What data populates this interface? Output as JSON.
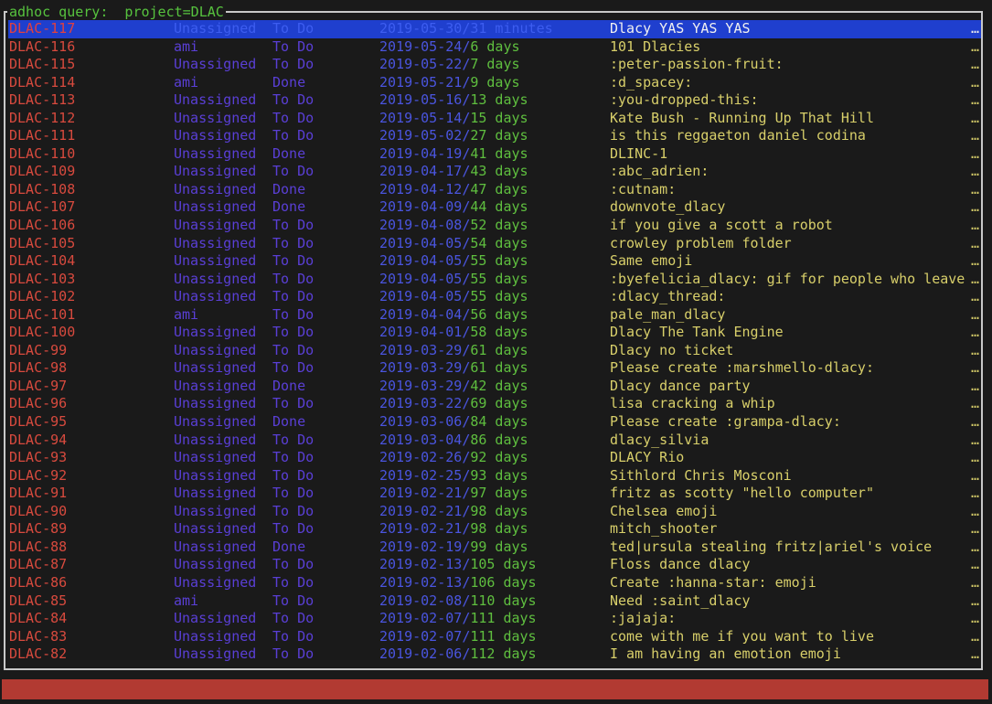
{
  "window": {
    "title": "adhoc query:  project=DLAC"
  },
  "ellipsis": "…",
  "issues": [
    {
      "key": "DLAC-117",
      "assignee": "Unassigned",
      "status": "To Do",
      "date": "2019-05-30",
      "age": "31 minutes",
      "summary": "Dlacy YAS YAS YAS",
      "selected": true
    },
    {
      "key": "DLAC-116",
      "assignee": "ami",
      "status": "To Do",
      "date": "2019-05-24",
      "age": "6 days",
      "summary": "101 Dlacies"
    },
    {
      "key": "DLAC-115",
      "assignee": "Unassigned",
      "status": "To Do",
      "date": "2019-05-22",
      "age": "7 days",
      "summary": ":peter-passion-fruit:"
    },
    {
      "key": "DLAC-114",
      "assignee": "ami",
      "status": "Done",
      "date": "2019-05-21",
      "age": "9 days",
      "summary": ":d_spacey:"
    },
    {
      "key": "DLAC-113",
      "assignee": "Unassigned",
      "status": "To Do",
      "date": "2019-05-16",
      "age": "13 days",
      "summary": ":you-dropped-this:"
    },
    {
      "key": "DLAC-112",
      "assignee": "Unassigned",
      "status": "To Do",
      "date": "2019-05-14",
      "age": "15 days",
      "summary": "Kate Bush - Running Up That Hill"
    },
    {
      "key": "DLAC-111",
      "assignee": "Unassigned",
      "status": "To Do",
      "date": "2019-05-02",
      "age": "27 days",
      "summary": "is this reggaeton daniel codina"
    },
    {
      "key": "DLAC-110",
      "assignee": "Unassigned",
      "status": "Done",
      "date": "2019-04-19",
      "age": "41 days",
      "summary": "DLINC-1"
    },
    {
      "key": "DLAC-109",
      "assignee": "Unassigned",
      "status": "To Do",
      "date": "2019-04-17",
      "age": "43 days",
      "summary": ":abc_adrien:"
    },
    {
      "key": "DLAC-108",
      "assignee": "Unassigned",
      "status": "Done",
      "date": "2019-04-12",
      "age": "47 days",
      "summary": ":cutnam:"
    },
    {
      "key": "DLAC-107",
      "assignee": "Unassigned",
      "status": "Done",
      "date": "2019-04-09",
      "age": "44 days",
      "summary": "downvote_dlacy"
    },
    {
      "key": "DLAC-106",
      "assignee": "Unassigned",
      "status": "To Do",
      "date": "2019-04-08",
      "age": "52 days",
      "summary": "if you give a scott a robot"
    },
    {
      "key": "DLAC-105",
      "assignee": "Unassigned",
      "status": "To Do",
      "date": "2019-04-05",
      "age": "54 days",
      "summary": "crowley problem folder"
    },
    {
      "key": "DLAC-104",
      "assignee": "Unassigned",
      "status": "To Do",
      "date": "2019-04-05",
      "age": "55 days",
      "summary": "Same emoji"
    },
    {
      "key": "DLAC-103",
      "assignee": "Unassigned",
      "status": "To Do",
      "date": "2019-04-05",
      "age": "55 days",
      "summary": ":byefelicia_dlacy: gif for people who leave"
    },
    {
      "key": "DLAC-102",
      "assignee": "Unassigned",
      "status": "To Do",
      "date": "2019-04-05",
      "age": "55 days",
      "summary": ":dlacy_thread:"
    },
    {
      "key": "DLAC-101",
      "assignee": "ami",
      "status": "To Do",
      "date": "2019-04-04",
      "age": "56 days",
      "summary": "pale_man_dlacy"
    },
    {
      "key": "DLAC-100",
      "assignee": "Unassigned",
      "status": "To Do",
      "date": "2019-04-01",
      "age": "58 days",
      "summary": "Dlacy The Tank Engine"
    },
    {
      "key": "DLAC-99",
      "assignee": "Unassigned",
      "status": "To Do",
      "date": "2019-03-29",
      "age": "61 days",
      "summary": "Dlacy no ticket"
    },
    {
      "key": "DLAC-98",
      "assignee": "Unassigned",
      "status": "To Do",
      "date": "2019-03-29",
      "age": "61 days",
      "summary": "Please create :marshmello-dlacy:"
    },
    {
      "key": "DLAC-97",
      "assignee": "Unassigned",
      "status": "Done",
      "date": "2019-03-29",
      "age": "42 days",
      "summary": "Dlacy dance party"
    },
    {
      "key": "DLAC-96",
      "assignee": "Unassigned",
      "status": "To Do",
      "date": "2019-03-22",
      "age": "69 days",
      "summary": "lisa cracking a whip"
    },
    {
      "key": "DLAC-95",
      "assignee": "Unassigned",
      "status": "Done",
      "date": "2019-03-06",
      "age": "84 days",
      "summary": "Please create :grampa-dlacy:"
    },
    {
      "key": "DLAC-94",
      "assignee": "Unassigned",
      "status": "To Do",
      "date": "2019-03-04",
      "age": "86 days",
      "summary": "dlacy_silvia"
    },
    {
      "key": "DLAC-93",
      "assignee": "Unassigned",
      "status": "To Do",
      "date": "2019-02-26",
      "age": "92 days",
      "summary": "DLACY Rio"
    },
    {
      "key": "DLAC-92",
      "assignee": "Unassigned",
      "status": "To Do",
      "date": "2019-02-25",
      "age": "93 days",
      "summary": "Sithlord Chris Mosconi"
    },
    {
      "key": "DLAC-91",
      "assignee": "Unassigned",
      "status": "To Do",
      "date": "2019-02-21",
      "age": "97 days",
      "summary": "fritz as scotty \"hello computer\""
    },
    {
      "key": "DLAC-90",
      "assignee": "Unassigned",
      "status": "To Do",
      "date": "2019-02-21",
      "age": "98 days",
      "summary": "Chelsea emoji"
    },
    {
      "key": "DLAC-89",
      "assignee": "Unassigned",
      "status": "To Do",
      "date": "2019-02-21",
      "age": "98 days",
      "summary": "mitch_shooter"
    },
    {
      "key": "DLAC-88",
      "assignee": "Unassigned",
      "status": "Done",
      "date": "2019-02-19",
      "age": "99 days",
      "summary": "ted|ursula stealing fritz|ariel's voice"
    },
    {
      "key": "DLAC-87",
      "assignee": "Unassigned",
      "status": "To Do",
      "date": "2019-02-13",
      "age": "105 days",
      "summary": "Floss dance dlacy"
    },
    {
      "key": "DLAC-86",
      "assignee": "Unassigned",
      "status": "To Do",
      "date": "2019-02-13",
      "age": "106 days",
      "summary": "Create :hanna-star: emoji"
    },
    {
      "key": "DLAC-85",
      "assignee": "ami",
      "status": "To Do",
      "date": "2019-02-08",
      "age": "110 days",
      "summary": "Need :saint_dlacy"
    },
    {
      "key": "DLAC-84",
      "assignee": "Unassigned",
      "status": "To Do",
      "date": "2019-02-07",
      "age": "111 days",
      "summary": ":jajaja:"
    },
    {
      "key": "DLAC-83",
      "assignee": "Unassigned",
      "status": "To Do",
      "date": "2019-02-07",
      "age": "111 days",
      "summary": "come with me if you want to live"
    },
    {
      "key": "DLAC-82",
      "assignee": "Unassigned",
      "status": "To Do",
      "date": "2019-02-06",
      "age": "112 days",
      "summary": "I am having an emotion emoji"
    }
  ],
  "colors": {
    "key": "#d84a3e",
    "assignee": "#5a3fd6",
    "date": "#4a55df",
    "age": "#5fbf3f",
    "summary": "#d8cf6a",
    "selection": "#1f3fce",
    "statusbar": "#b23a32"
  }
}
